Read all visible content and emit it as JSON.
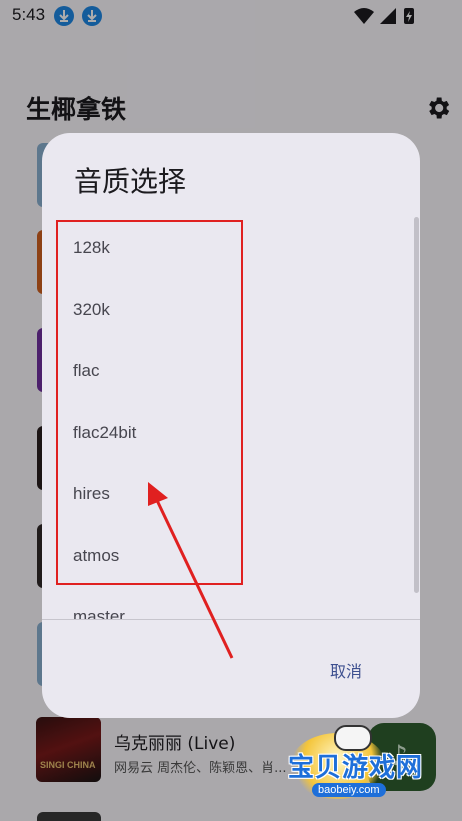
{
  "status_bar": {
    "time": "5:43"
  },
  "app": {
    "title": "生椰拿铁"
  },
  "background_song": {
    "title": "乌克丽丽 (Live)",
    "subtitle": "网易云    周杰伦、陈颖恩、肖...",
    "cover_text": "SINGI CHINA"
  },
  "dialog": {
    "title": "音质选择",
    "options": [
      "128k",
      "320k",
      "flac",
      "flac24bit",
      "hires",
      "atmos",
      "master"
    ],
    "cancel_label": "取消"
  },
  "watermark": {
    "text": "宝贝游戏网",
    "url": "baobeiy.com"
  },
  "colors": {
    "dialog_bg": "#eae8f0",
    "accent": "#3d4f8f",
    "annotation": "#e02020",
    "scrim": "rgba(0,0,0,0.32)"
  },
  "icons": {
    "status": [
      "download-icon",
      "download-icon",
      "wifi-icon",
      "signal-icon",
      "battery-icon"
    ],
    "header": "gear-icon",
    "fab": "music-note-icon"
  }
}
